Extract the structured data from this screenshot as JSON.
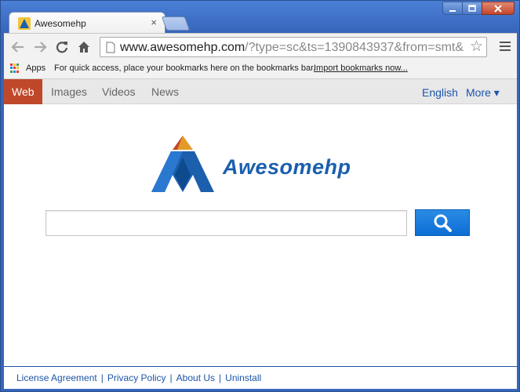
{
  "window": {
    "tab_title": "Awesomehp",
    "tab_close": "×",
    "controls": {
      "minimize": "▁",
      "maximize": "▢",
      "close": "✕"
    }
  },
  "toolbar": {
    "url_host": "www.awesomehp.com",
    "url_rest": "/?type=sc&ts=1390843937&from=smt&",
    "back_icon": "back-arrow-icon",
    "forward_icon": "forward-arrow-icon",
    "reload_icon": "reload-icon",
    "home_icon": "home-icon",
    "star": "☆"
  },
  "bookmarks": {
    "apps_label": "Apps",
    "hint": "For quick access, place your bookmarks here on the bookmarks bar.",
    "import_link": "Import bookmarks now..."
  },
  "page": {
    "nav_tabs": [
      "Web",
      "Images",
      "Videos",
      "News"
    ],
    "active_tab": "Web",
    "language": "English",
    "more": "More ▾",
    "logo_text": "Awesomehp",
    "search_value": "",
    "footer_links": [
      "License Agreement",
      "Privacy Policy",
      "About Us",
      "Uninstall"
    ],
    "footer_sep": "|"
  },
  "colors": {
    "active_tab": "#c0482a",
    "link_blue": "#1d55a8",
    "search_button": "#0c6ed4",
    "logo_blue": "#1b5fad"
  }
}
